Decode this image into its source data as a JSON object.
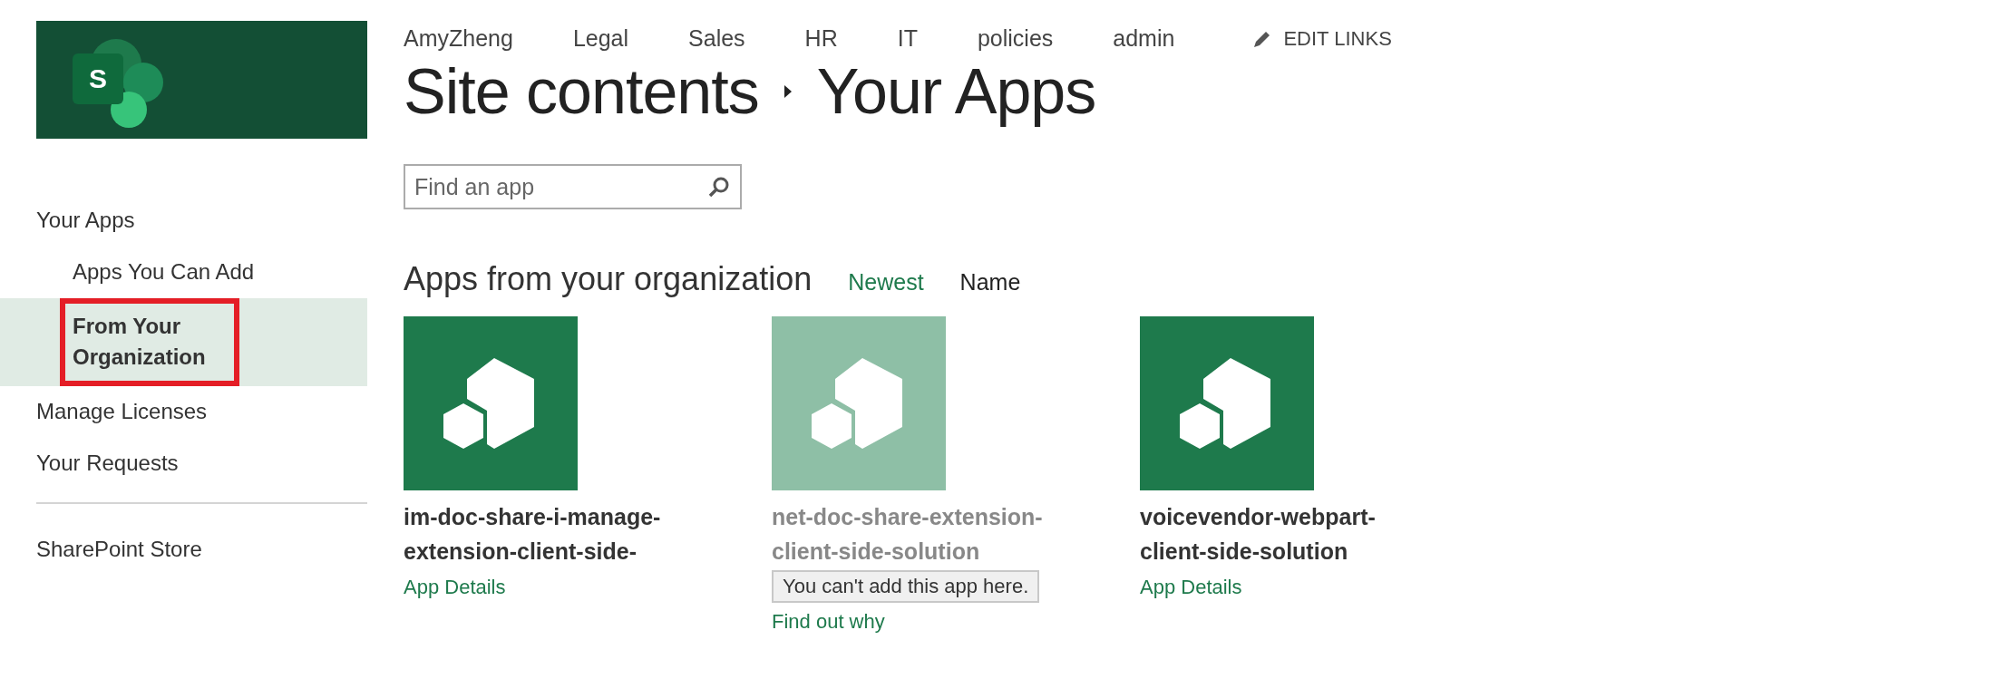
{
  "logo": {
    "letter": "S"
  },
  "top_nav": {
    "links": [
      "AmyZheng",
      "Legal",
      "Sales",
      "HR",
      "IT",
      "policies",
      "admin"
    ],
    "edit_links": "EDIT LINKS"
  },
  "breadcrumb": [
    "Site contents",
    "Your Apps"
  ],
  "sidebar": {
    "sections": [
      {
        "items": [
          {
            "label": "Your Apps",
            "selected": false,
            "highlighted": false,
            "children": [
              {
                "label": "Apps You Can Add",
                "selected": false,
                "highlighted": false
              },
              {
                "label": "From Your Organization",
                "selected": true,
                "highlighted": true
              }
            ]
          },
          {
            "label": "Manage Licenses",
            "selected": false,
            "highlighted": false
          },
          {
            "label": "Your Requests",
            "selected": false,
            "highlighted": false
          }
        ]
      },
      {
        "items": [
          {
            "label": "SharePoint Store",
            "selected": false,
            "highlighted": false
          }
        ]
      }
    ]
  },
  "search": {
    "placeholder": "Find an app"
  },
  "section": {
    "title": "Apps from your organization",
    "sort_options": [
      {
        "label": "Newest",
        "selected": false
      },
      {
        "label": "Name",
        "selected": true
      }
    ]
  },
  "apps": [
    {
      "name": "im-doc-share-i-manage-extension-client-side-",
      "available": true,
      "link": "App Details"
    },
    {
      "name": "net-doc-share-extension-client-side-solution",
      "available": false,
      "message": "You can't add this app here.",
      "link": "Find out why"
    },
    {
      "name": "voicevendor-webpart-client-side-solution",
      "available": true,
      "link": "App Details"
    }
  ]
}
